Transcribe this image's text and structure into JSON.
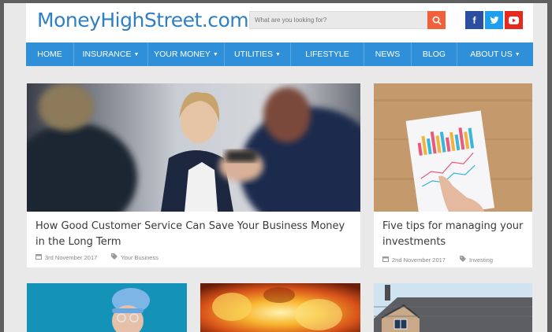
{
  "site": {
    "logo": "MoneyHighStreet.com",
    "search_placeholder": "What are you looking for?",
    "social": [
      "facebook-icon",
      "twitter-icon",
      "youtube-icon"
    ]
  },
  "nav": {
    "items": [
      {
        "label": "HOME",
        "dropdown": false
      },
      {
        "label": "INSURANCE",
        "dropdown": true
      },
      {
        "label": "YOUR MONEY",
        "dropdown": true
      },
      {
        "label": "UTILITIES",
        "dropdown": true
      },
      {
        "label": "LIFESTYLE",
        "dropdown": false
      },
      {
        "label": "NEWS",
        "dropdown": false
      },
      {
        "label": "BLOG",
        "dropdown": false
      },
      {
        "label": "ABOUT US",
        "dropdown": true
      }
    ]
  },
  "articles": [
    {
      "title": "How Good Customer Service Can Save Your Business Money in the Long Term",
      "date": "3rd November 2017",
      "category": "Your Business"
    },
    {
      "title": "Five tips for managing your investments",
      "date": "2nd November 2017",
      "category": "Investing"
    }
  ],
  "colors": {
    "accent": "#2f8fd8",
    "logo": "#2f7fc4",
    "search_button": "#f0613b"
  }
}
